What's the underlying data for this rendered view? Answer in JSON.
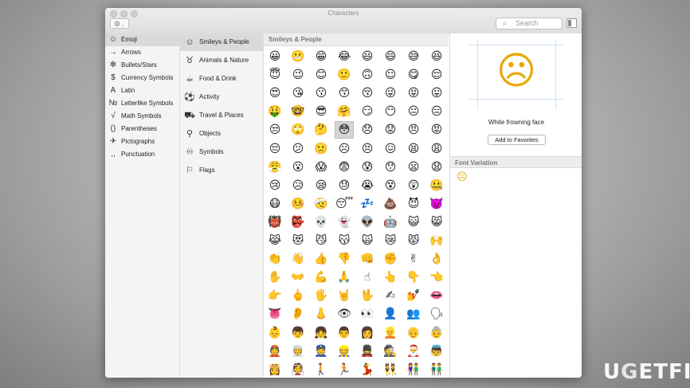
{
  "window": {
    "title": "Characters",
    "search_placeholder": "Search",
    "gear_icon": "gear-icon",
    "gear_glyph": "⚙",
    "chevron": "⌄",
    "search_glyph": "⌕"
  },
  "categories": [
    {
      "label": "Emoji",
      "icon": "☺",
      "selected": true
    },
    {
      "label": "Arrows",
      "icon": "→"
    },
    {
      "label": "Bullets/Stars",
      "icon": "✻"
    },
    {
      "label": "Currency Symbols",
      "icon": "$"
    },
    {
      "label": "Latin",
      "icon": "A"
    },
    {
      "label": "Letterlike Symbols",
      "icon": "№"
    },
    {
      "label": "Math Symbols",
      "icon": "√"
    },
    {
      "label": "Parentheses",
      "icon": "()"
    },
    {
      "label": "Pictographs",
      "icon": "✈"
    },
    {
      "label": "Punctuation",
      "icon": ",,"
    }
  ],
  "subcategories": [
    {
      "label": "Smileys & People",
      "icon": "☺",
      "selected": true
    },
    {
      "label": "Animals & Nature",
      "icon": "♉"
    },
    {
      "label": "Food & Drink",
      "icon": "☕"
    },
    {
      "label": "Activity",
      "icon": "⚽"
    },
    {
      "label": "Travel & Places",
      "icon": "⛟"
    },
    {
      "label": "Objects",
      "icon": "⚲"
    },
    {
      "label": "Symbols",
      "icon": "♾"
    },
    {
      "label": "Flags",
      "icon": "⚐"
    }
  ],
  "grid": {
    "header": "Smileys & People",
    "selected_index": 35,
    "rows": [
      [
        "😀",
        "😬",
        "😁",
        "😂",
        "😃",
        "😄",
        "😅",
        "😆"
      ],
      [
        "😇",
        "😉",
        "😊",
        "🙂",
        "🙃",
        "☺",
        "😋",
        "😌"
      ],
      [
        "😍",
        "😘",
        "😗",
        "😙",
        "😚",
        "😜",
        "😝",
        "😛"
      ],
      [
        "🤑",
        "🤓",
        "😎",
        "🤗",
        "😏",
        "😶",
        "😐",
        "😑"
      ],
      [
        "😒",
        "🙄",
        "🤔",
        "😳",
        "😞",
        "😟",
        "😠",
        "😡"
      ],
      [
        "😔",
        "😕",
        "🙁",
        "☹",
        "😣",
        "😖",
        "😫",
        "😩"
      ],
      [
        "😤",
        "😮",
        "😱",
        "😨",
        "😰",
        "😯",
        "😦",
        "😧"
      ],
      [
        "😢",
        "😥",
        "😪",
        "😓",
        "😭",
        "😵",
        "😲",
        "🤐"
      ],
      [
        "😷",
        "🤒",
        "🤕",
        "😴",
        "💤",
        "💩",
        "😈",
        "👿"
      ],
      [
        "👹",
        "👺",
        "💀",
        "👻",
        "👽",
        "🤖",
        "😺",
        "😸"
      ],
      [
        "😹",
        "😻",
        "😼",
        "😽",
        "🙀",
        "😿",
        "😾",
        "🙌"
      ],
      [
        "👏",
        "👋",
        "👍",
        "👎",
        "👊",
        "✊",
        "✌",
        "👌"
      ],
      [
        "✋",
        "👐",
        "💪",
        "🙏",
        "☝",
        "👆",
        "👇",
        "👈"
      ],
      [
        "👉",
        "🖕",
        "🖐",
        "🤘",
        "🖖",
        "✍",
        "💅",
        "👄"
      ],
      [
        "👅",
        "👂",
        "👃",
        "👁",
        "👀",
        "👤",
        "👥",
        "🗣"
      ],
      [
        "👶",
        "👦",
        "👧",
        "👨",
        "👩",
        "👱",
        "👴",
        "👵"
      ],
      [
        "👲",
        "👳",
        "👮",
        "👷",
        "💂",
        "🕵",
        "🎅",
        "👼"
      ],
      [
        "👸",
        "👰",
        "🚶",
        "🏃",
        "💃",
        "👯",
        "👫",
        "👬"
      ]
    ]
  },
  "detail": {
    "glyph": "☹",
    "name": "White frowning face",
    "favorite_button": "Add to Favorites",
    "font_variation_header": "Font Variation",
    "font_variation_glyph": "☹"
  },
  "watermark": {
    "text_a": "U",
    "text_b": "G",
    "text_c": "ETFIX"
  }
}
